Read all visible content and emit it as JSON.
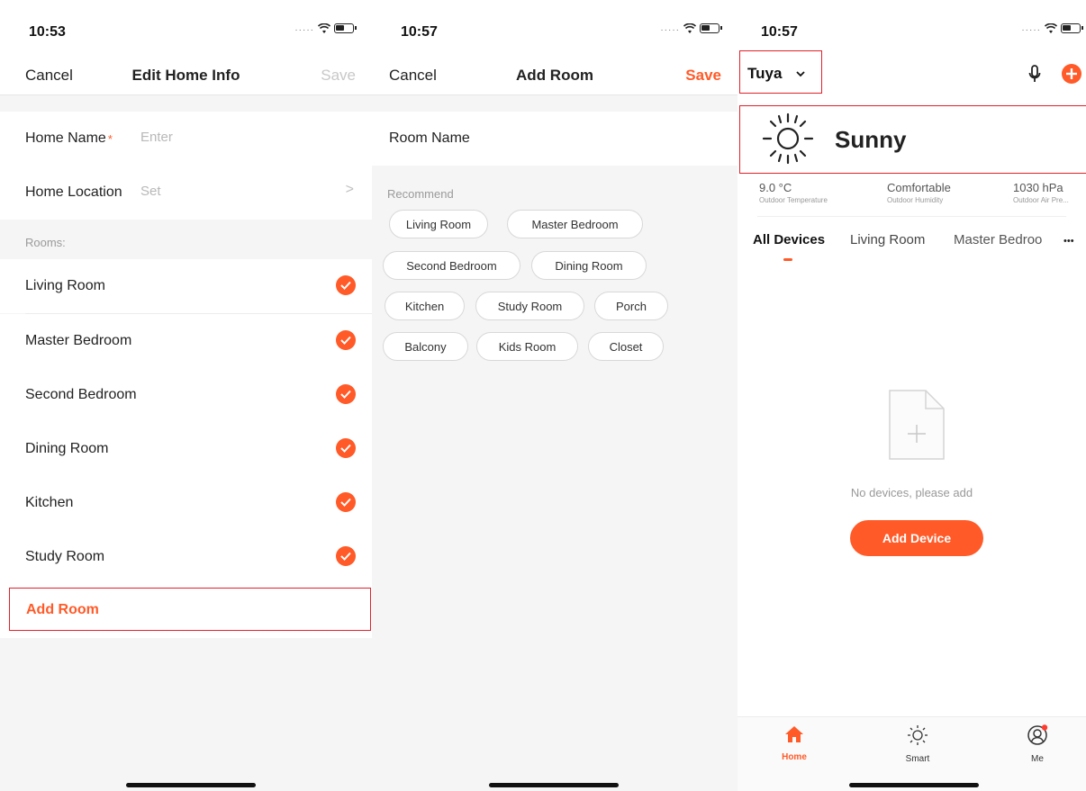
{
  "edit_home": {
    "status_time": "10:53",
    "nav": {
      "cancel": "Cancel",
      "title": "Edit Home Info",
      "save": "Save"
    },
    "home_name": {
      "label": "Home Name",
      "required_mark": "*",
      "placeholder": "Enter"
    },
    "home_location": {
      "label": "Home Location",
      "placeholder": "Set",
      "chevron": ">"
    },
    "rooms_label": "Rooms:",
    "rooms": [
      {
        "name": "Living Room",
        "checked": true
      },
      {
        "name": "Master Bedroom",
        "checked": true
      },
      {
        "name": "Second Bedroom",
        "checked": true
      },
      {
        "name": "Dining Room",
        "checked": true
      },
      {
        "name": "Kitchen",
        "checked": true
      },
      {
        "name": "Study Room",
        "checked": true
      }
    ],
    "add_room": "Add Room"
  },
  "add_room": {
    "status_time": "10:57",
    "nav": {
      "cancel": "Cancel",
      "title": "Add Room",
      "save": "Save"
    },
    "room_name_label": "Room Name",
    "recommend_label": "Recommend",
    "chips": [
      "Living Room",
      "Master Bedroom",
      "Second Bedroom",
      "Dining Room",
      "Kitchen",
      "Study Room",
      "Porch",
      "Balcony",
      "Kids Room",
      "Closet"
    ]
  },
  "home": {
    "status_time": "10:57",
    "home_name": "Tuya",
    "weather": "Sunny",
    "stats": [
      {
        "value": "9.0 °C",
        "label": "Outdoor Temperature"
      },
      {
        "value": "Comfortable",
        "label": "Outdoor Humidity"
      },
      {
        "value": "1030 hPa",
        "label": "Outdoor Air Pre..."
      }
    ],
    "tabs": [
      "All Devices",
      "Living Room",
      "Master Bedroo"
    ],
    "more": "•••",
    "empty_text": "No devices, please add",
    "add_device": "Add Device",
    "tabbar": [
      "Home",
      "Smart",
      "Me"
    ]
  },
  "colors": {
    "accent": "#ff5a28",
    "highlight_border": "#e0202a"
  }
}
